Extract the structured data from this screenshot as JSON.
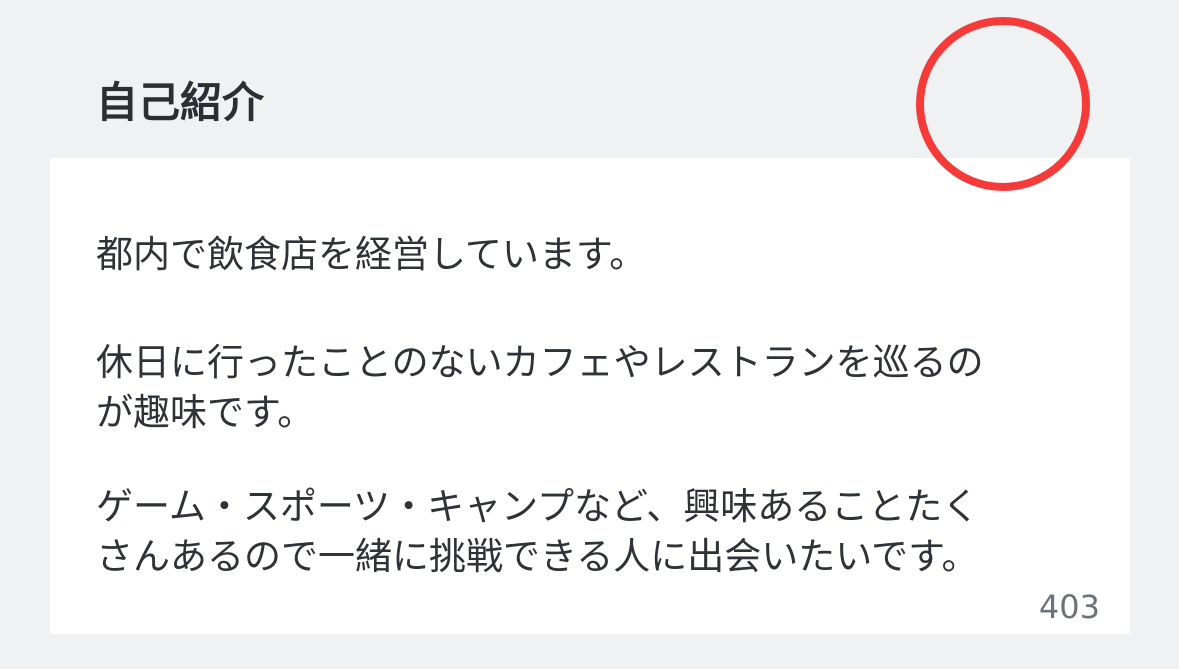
{
  "profile": {
    "section_title": "自己紹介",
    "bio_paragraphs": [
      "都内で飲食店を経営しています。",
      "休日に行ったことのないカフェやレストランを巡るの\nが趣味です。",
      "ゲーム・スポーツ・キャンプなど、興味あることたく\nさんあるので一緒に挑戦できる人に出会いたいです。"
    ],
    "char_count": "403"
  },
  "colors": {
    "page_background": "#f0f1f3",
    "card_background": "#ffffff",
    "title_text": "#2b2e33",
    "body_text": "#2f3236",
    "counter_text": "#6d7178",
    "annotation_circle": "#f53a3a"
  }
}
